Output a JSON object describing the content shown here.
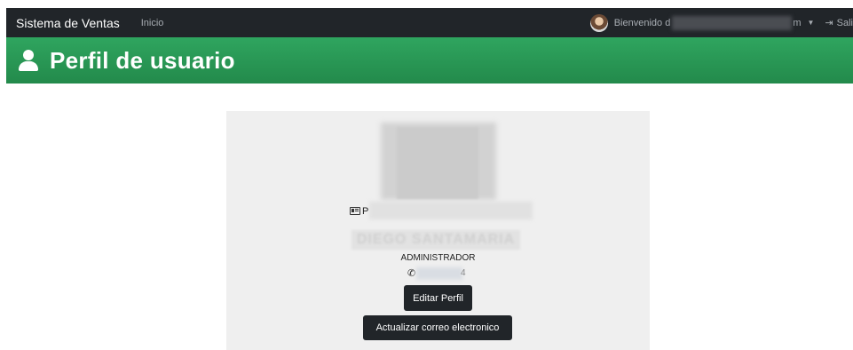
{
  "navbar": {
    "brand": "Sistema de Ventas",
    "home_link": "Inicio",
    "welcome": "Bienvenido",
    "email_visible_prefix": "d",
    "email_visible_suffix": "m",
    "logout": "Sali"
  },
  "header": {
    "title": "Perfil de usuario",
    "color": "#28a45a"
  },
  "profile": {
    "id_prefix": "P",
    "name": "DIEGO SANTAMARIA",
    "role": "ADMINISTRADOR",
    "phone_suffix": "4",
    "edit_button": "Editar Perfil",
    "update_email_button": "Actualizar correo electronico"
  },
  "icons": {
    "brand_header": "user-icon",
    "id": "id-card-icon",
    "phone": "phone-icon",
    "logout": "sign-out-icon",
    "dropdown": "caret-down-icon"
  }
}
